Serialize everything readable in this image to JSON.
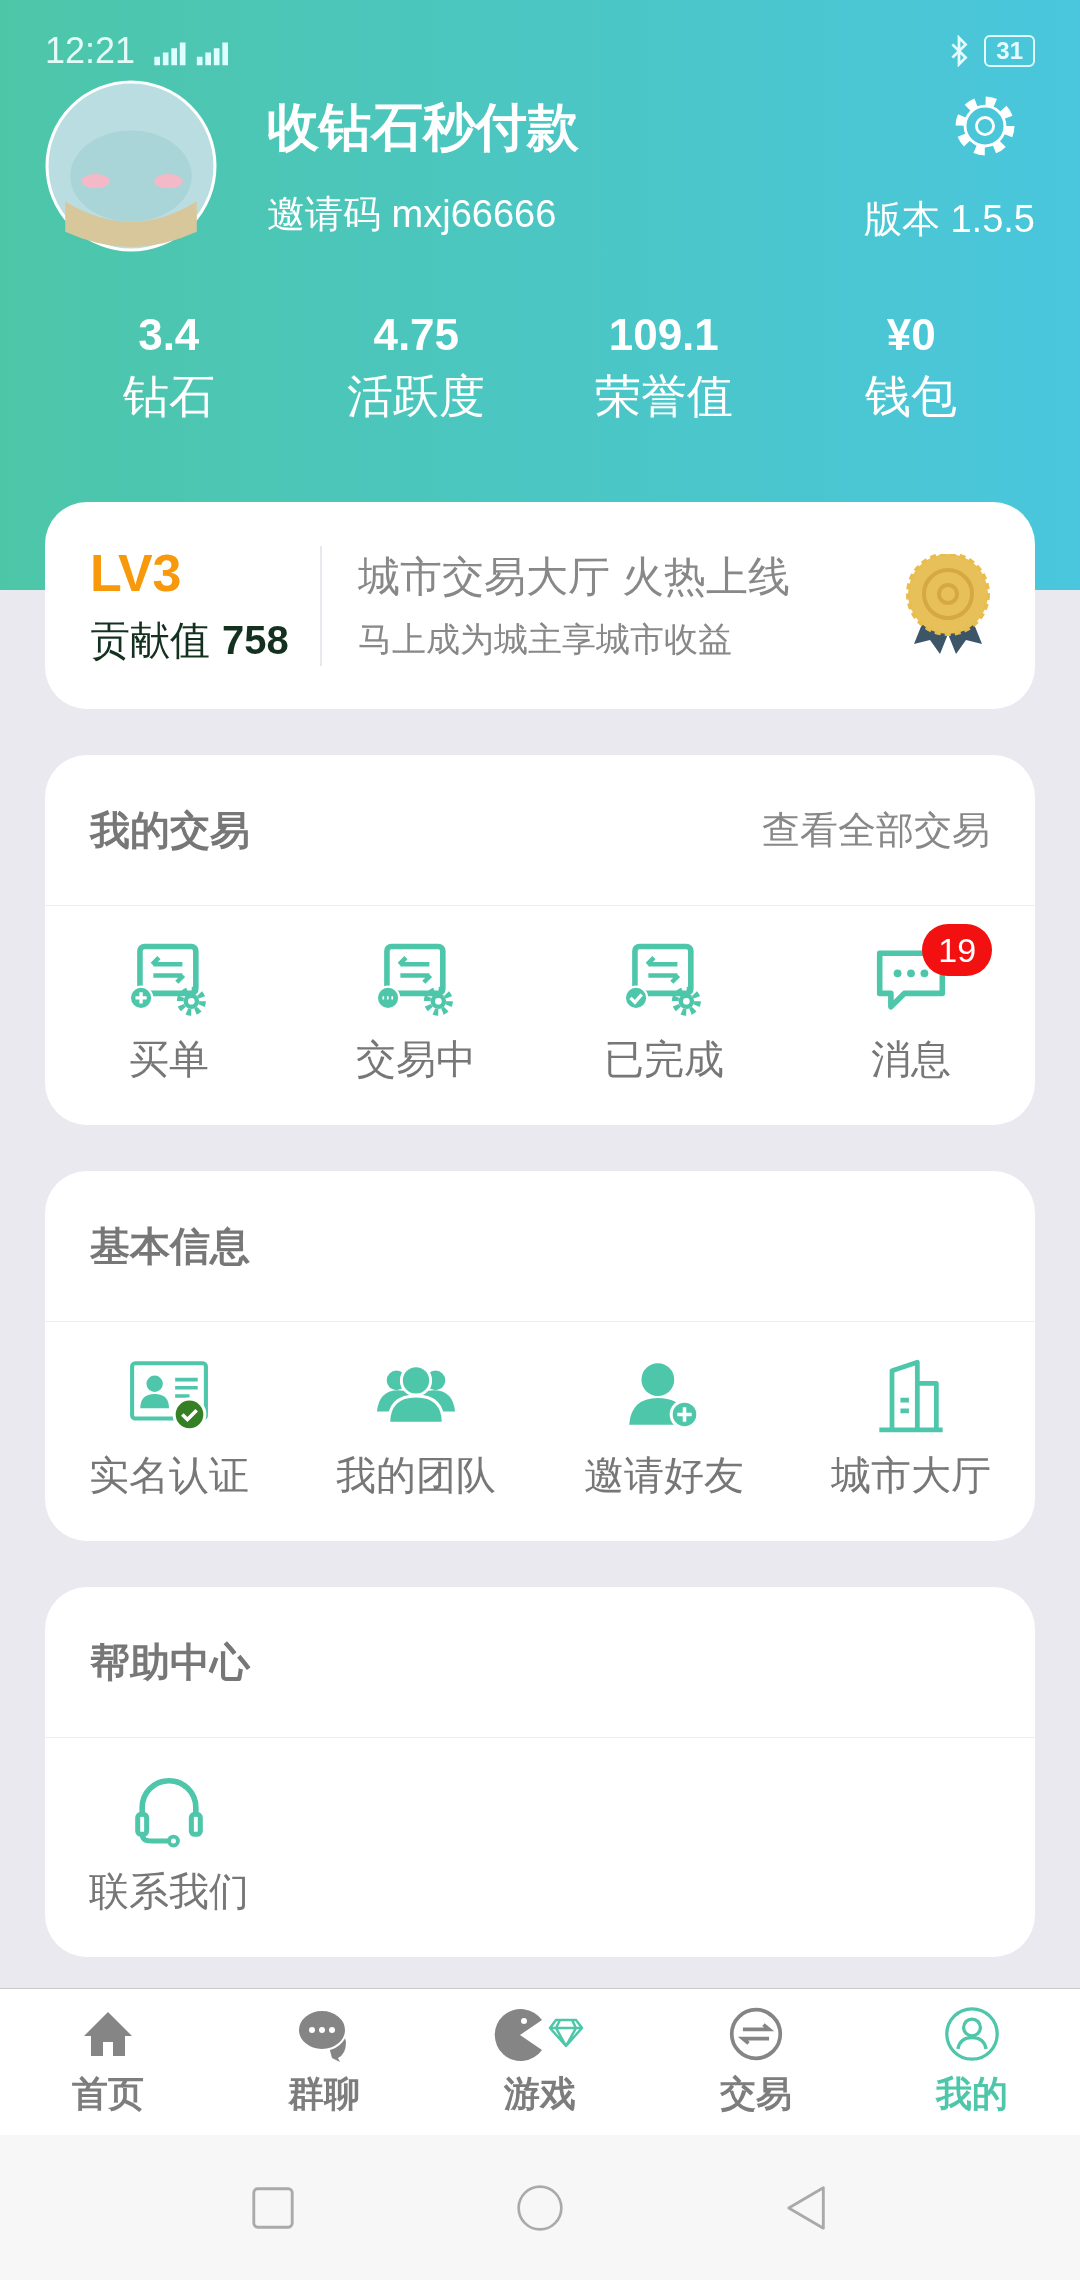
{
  "status_bar": {
    "time": "12:21",
    "battery": "31"
  },
  "profile": {
    "name": "收钻石秒付款",
    "invite_code": "邀请码 mxj66666",
    "version": "版本 1.5.5"
  },
  "stats": [
    {
      "value": "3.4",
      "label": "钻石"
    },
    {
      "value": "4.75",
      "label": "活跃度"
    },
    {
      "value": "109.1",
      "label": "荣誉值"
    },
    {
      "value": "¥0",
      "label": "钱包"
    }
  ],
  "level_card": {
    "level": "LV3",
    "contribution_label": "贡献值",
    "contribution_value": "758",
    "promo_title": "城市交易大厅 火热上线",
    "promo_subtitle": "马上成为城主享城市收益"
  },
  "sections": [
    {
      "title": "我的交易",
      "link": "查看全部交易",
      "items": [
        {
          "kind": "buy-order",
          "label": "买单"
        },
        {
          "kind": "trading",
          "label": "交易中"
        },
        {
          "kind": "completed",
          "label": "已完成"
        },
        {
          "kind": "message",
          "label": "消息",
          "badge": "19"
        }
      ]
    },
    {
      "title": "基本信息",
      "items": [
        {
          "kind": "id-verify",
          "label": "实名认证"
        },
        {
          "kind": "team",
          "label": "我的团队"
        },
        {
          "kind": "invite",
          "label": "邀请好友"
        },
        {
          "kind": "city",
          "label": "城市大厅"
        }
      ]
    },
    {
      "title": "帮助中心",
      "items": [
        {
          "kind": "contact",
          "label": "联系我们"
        }
      ]
    }
  ],
  "tab_bar": [
    {
      "kind": "home",
      "label": "首页",
      "selected": false
    },
    {
      "kind": "chat",
      "label": "群聊",
      "selected": false
    },
    {
      "kind": "game",
      "label": "游戏",
      "selected": false
    },
    {
      "kind": "trade",
      "label": "交易",
      "selected": false
    },
    {
      "kind": "me",
      "label": "我的",
      "selected": true
    }
  ]
}
